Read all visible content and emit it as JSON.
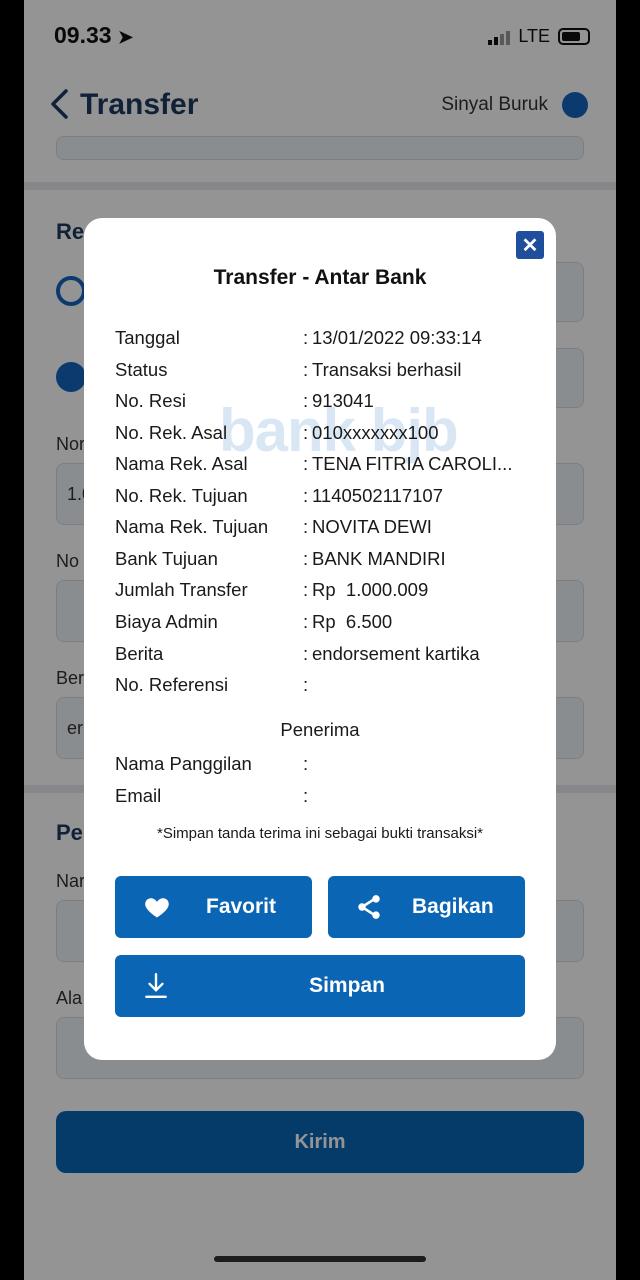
{
  "status_bar": {
    "time": "09.33",
    "network": "LTE"
  },
  "header": {
    "title": "Transfer",
    "signal_label": "Sinyal Buruk"
  },
  "background": {
    "rek_label": "Re",
    "nom_label": "Nor",
    "nom_value": "1.0",
    "no_label": "No",
    "ber_label": "Ber",
    "ber_value": "er",
    "pe_label": "Pe",
    "nam_label": "Nar",
    "ala_label": "Ala",
    "kirim_label": "Kirim"
  },
  "modal": {
    "title": "Transfer - Antar Bank",
    "watermark": "bank bjb",
    "close_icon": "close-icon",
    "rows": [
      {
        "key": "Tanggal",
        "value": "13/01/2022 09:33:14"
      },
      {
        "key": "Status",
        "value": "Transaksi berhasil"
      },
      {
        "key": "No. Resi",
        "value": "913041"
      },
      {
        "key": "No. Rek. Asal",
        "value": "010xxxxxxx100"
      },
      {
        "key": "Nama Rek. Asal",
        "value": "TENA FITRIA CAROLI..."
      },
      {
        "key": "No. Rek. Tujuan",
        "value": "1140502117107"
      },
      {
        "key": "Nama Rek. Tujuan",
        "value": "NOVITA DEWI"
      },
      {
        "key": "Bank Tujuan",
        "value": "BANK MANDIRI"
      },
      {
        "key": "Jumlah Transfer",
        "value": "Rp  1.000.009"
      },
      {
        "key": "Biaya Admin",
        "value": "Rp  6.500"
      },
      {
        "key": "Berita",
        "value": "endorsement kartika"
      },
      {
        "key": "No. Referensi",
        "value": ""
      }
    ],
    "penerima_label": "Penerima",
    "penerima_rows": [
      {
        "key": "Nama Panggilan",
        "value": ""
      },
      {
        "key": "Email",
        "value": ""
      }
    ],
    "separator": ":",
    "note": "*Simpan tanda terima ini sebagai bukti transaksi*",
    "buttons": {
      "favorit": {
        "label": "Favorit",
        "icon": "heart-icon"
      },
      "bagikan": {
        "label": "Bagikan",
        "icon": "share-icon"
      },
      "simpan": {
        "label": "Simpan",
        "icon": "download-icon"
      }
    }
  },
  "colors": {
    "primary": "#0a66b5",
    "close_button": "#1f4e9c",
    "title": "#1e3a5f"
  }
}
